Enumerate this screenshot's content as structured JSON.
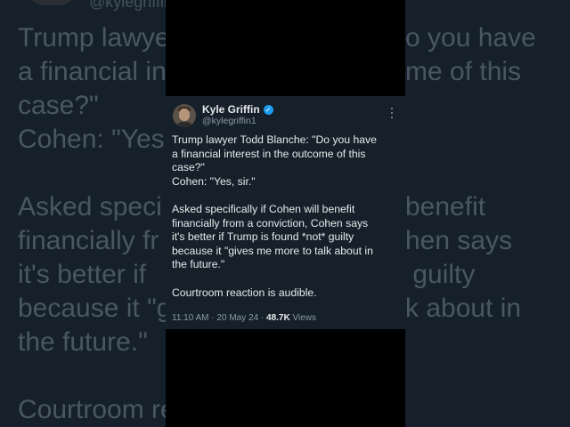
{
  "tweet": {
    "display_name": "Kyle Griffin",
    "handle": "@kylegriffin1",
    "verified_icon": "verified-badge-icon",
    "more_icon": "more-options-icon",
    "text_lines": [
      "Trump lawyer Todd Blanche: \"Do you have",
      "a financial interest in the outcome of this",
      "case?\"",
      "Cohen: \"Yes, sir.\"",
      "Asked specifically if Cohen will benefit",
      "financially from a conviction, Cohen says",
      "it's better if Trump is found *not* guilty",
      "because it \"gives me more to talk about in",
      "the future.\"",
      "Courtroom reaction is audible."
    ],
    "time": "11:10 AM",
    "separator": "·",
    "date": "20 May 24",
    "views_count": "48.7K",
    "views_label": "Views",
    "accent_color": "#1d9bf0",
    "background_color": "#15202b"
  },
  "background": {
    "left_text": "Trump lawye\na financial in\ncase?\"\nCohen: \"Yes\n\nAsked speci\nfinancially fr\nit's better if\nbecause it \"g\nthe future.\"\n\nCourtroom re",
    "right_text": "o you have\nme of this\n\n\n\nbenefit\nhen says\n guilty\nk about in\n\n\n",
    "top_handle": "@kylegriffin1"
  }
}
